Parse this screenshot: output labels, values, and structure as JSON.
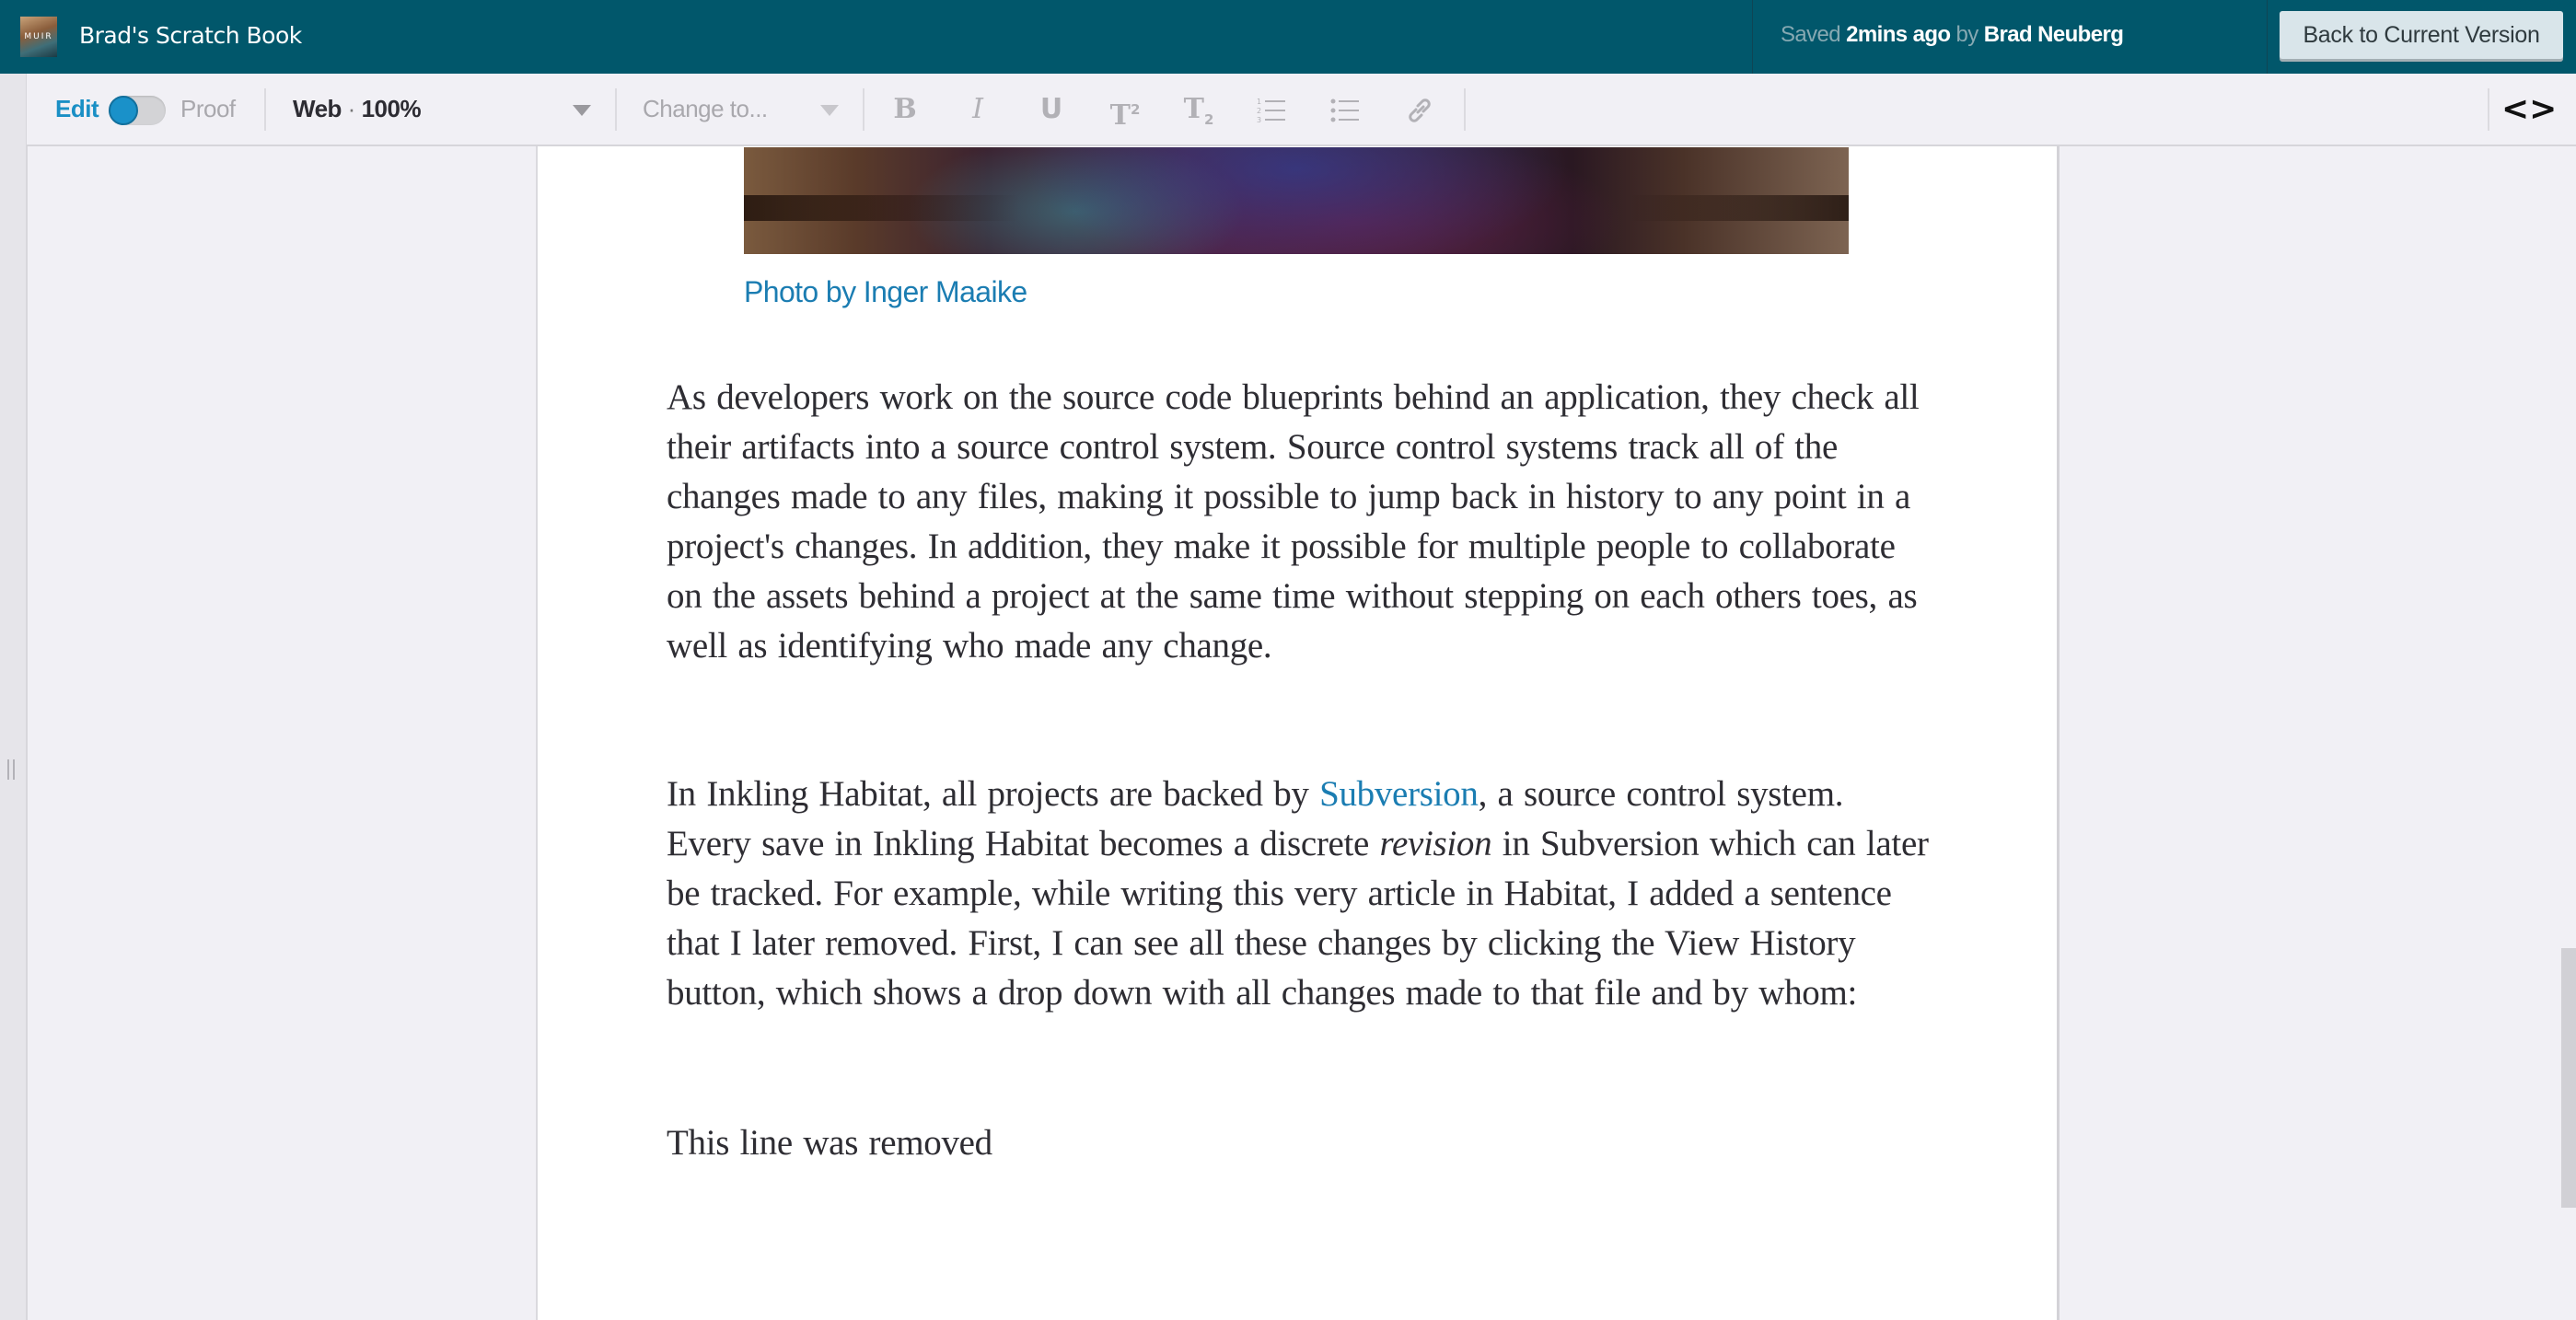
{
  "header": {
    "logo_text": "MUIR",
    "title": "Brad's Scratch Book",
    "status": {
      "saved_label": "Saved",
      "time": "2mins ago",
      "by_label": "by",
      "author": "Brad Neuberg"
    },
    "back_button": "Back to Current Version"
  },
  "toolbar": {
    "edit_label": "Edit",
    "proof_label": "Proof",
    "mode_toggle_state": "edit",
    "view_select": {
      "name": "Web",
      "separator": "·",
      "zoom": "100%"
    },
    "change_to_placeholder": "Change to...",
    "format_buttons": [
      {
        "name": "bold",
        "glyph": "B"
      },
      {
        "name": "italic",
        "glyph": "I"
      },
      {
        "name": "underline",
        "glyph": "U"
      },
      {
        "name": "superscript",
        "glyph": "T",
        "script": "2"
      },
      {
        "name": "subscript",
        "glyph": "T",
        "script": "2"
      },
      {
        "name": "ordered-list",
        "glyph": "ol-icon"
      },
      {
        "name": "unordered-list",
        "glyph": "ul-icon"
      },
      {
        "name": "link",
        "glyph": "link-icon"
      }
    ],
    "code_view_glyph": "<>"
  },
  "document": {
    "photo_caption": "Photo by Inger Maaike",
    "paragraph1": "As developers work on the source code blueprints behind an application, they check all their artifacts into a source control system. Source control systems track all of the changes made to any files, making it possible to jump back in history to any point in a project's changes. In addition, they make it possible for multiple people to collaborate on the assets behind a project at the same time without stepping on each others toes, as well as identifying who made any change.",
    "paragraph2": {
      "before_link": "In Inkling Habitat, all projects are backed by ",
      "link": "Subversion",
      "after_link": ", a source control system. Every save in Inkling Habitat becomes a discrete ",
      "italic": "revision",
      "after_italic": " in Subversion which can later be tracked. For example, while writing this very article in Habitat, I added a sentence that I later removed. First, I can see all these changes by clicking the View History button, which shows a drop down with all changes made to that file and by whom:"
    },
    "paragraph3": "This line was removed"
  },
  "colors": {
    "header_bg": "#01576b",
    "accent_blue": "#1b7db2",
    "toggle_blue": "#1a91c9",
    "toolbar_bg": "#f1f0f5"
  }
}
